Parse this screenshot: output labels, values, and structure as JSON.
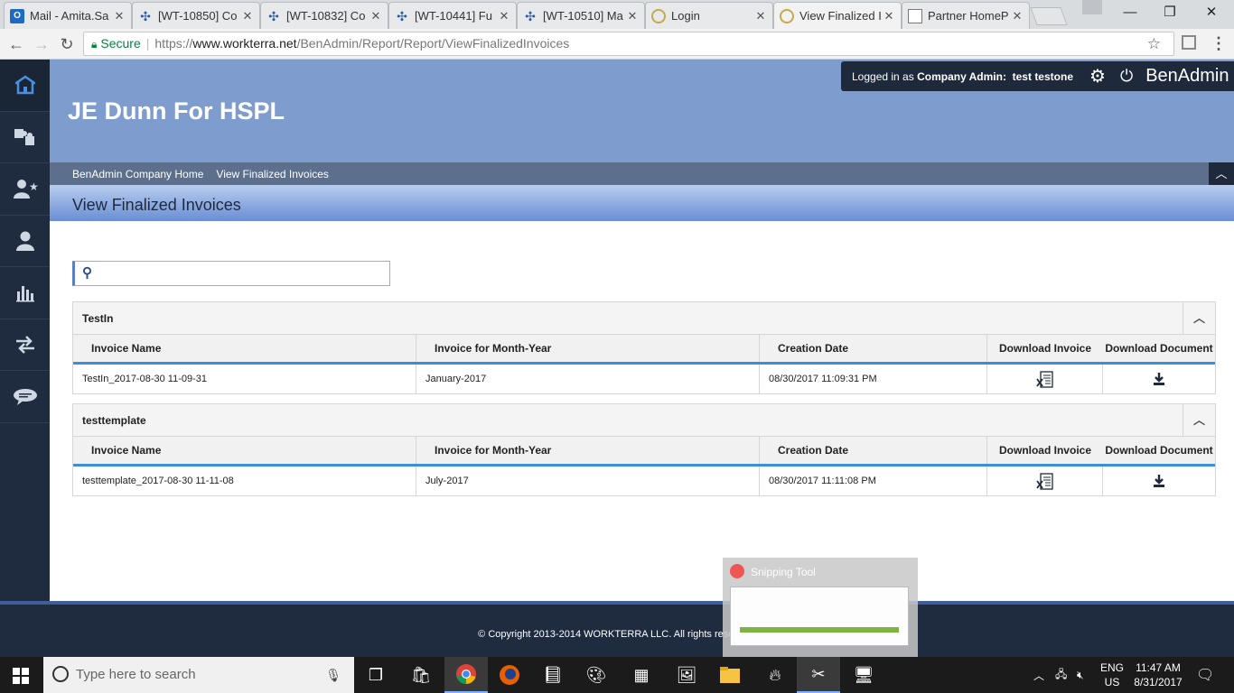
{
  "browser": {
    "tabs": [
      {
        "label": "Mail - Amita.Sa",
        "icon": "outlook-icon",
        "active": false
      },
      {
        "label": "[WT-10850] Co",
        "icon": "jira-icon",
        "active": false
      },
      {
        "label": "[WT-10832] Co",
        "icon": "jira-icon",
        "active": false
      },
      {
        "label": "[WT-10441] Fu",
        "icon": "jira-icon",
        "active": false
      },
      {
        "label": "[WT-10510] Ma",
        "icon": "jira-icon",
        "active": false
      },
      {
        "label": "Login",
        "icon": "site-icon",
        "active": false
      },
      {
        "label": "View Finalized I",
        "icon": "site-icon",
        "active": true
      },
      {
        "label": "Partner HomeP",
        "icon": "document-icon",
        "active": false
      }
    ],
    "address": {
      "secure_label": "Secure",
      "scheme": "https://",
      "domain": "www.workterra.net",
      "path": "/BenAdmin/Report/Report/ViewFinalizedInvoices"
    }
  },
  "app": {
    "company_name": "JE Dunn For HSPL",
    "user": {
      "logged_in_prefix": "Logged in as",
      "role": "Company Admin:",
      "name": "test testone",
      "brand": "BenAdmin"
    },
    "breadcrumbs": [
      "BenAdmin Company Home",
      "View Finalized Invoices"
    ],
    "page_title": "View Finalized Invoices",
    "search": {
      "placeholder": "",
      "value": ""
    },
    "columns": [
      "Invoice Name",
      "Invoice for Month-Year",
      "Creation Date",
      "Download Invoice",
      "Download Document"
    ],
    "panels": [
      {
        "title": "TestIn",
        "rows": [
          {
            "invoice_name": "TestIn_2017-08-30 11-09-31",
            "month_year": "January-2017",
            "creation_date": "08/30/2017 11:09:31 PM"
          }
        ]
      },
      {
        "title": "testtemplate",
        "rows": [
          {
            "invoice_name": "testtemplate_2017-08-30 11-11-08",
            "month_year": "July-2017",
            "creation_date": "08/30/2017 11:11:08 PM"
          }
        ]
      }
    ],
    "footer": "© Copyright 2013-2014 WORKTERRA LLC. All rights reserved.",
    "sidebar_icons": [
      "home-icon",
      "puzzle-icon",
      "user-star-icon",
      "user-icon",
      "bar-chart-icon",
      "transfer-icon",
      "chat-icon"
    ]
  },
  "snipping_tool": {
    "title": "Snipping Tool"
  },
  "taskbar": {
    "search_placeholder": "Type here to search",
    "language": "ENG",
    "region": "US",
    "time": "11:47 AM",
    "date": "8/31/2017"
  },
  "colors": {
    "header_blue": "#7f9ccf",
    "sidebar_navy": "#1f2b3e",
    "accent_blue": "#3a8fd6"
  }
}
